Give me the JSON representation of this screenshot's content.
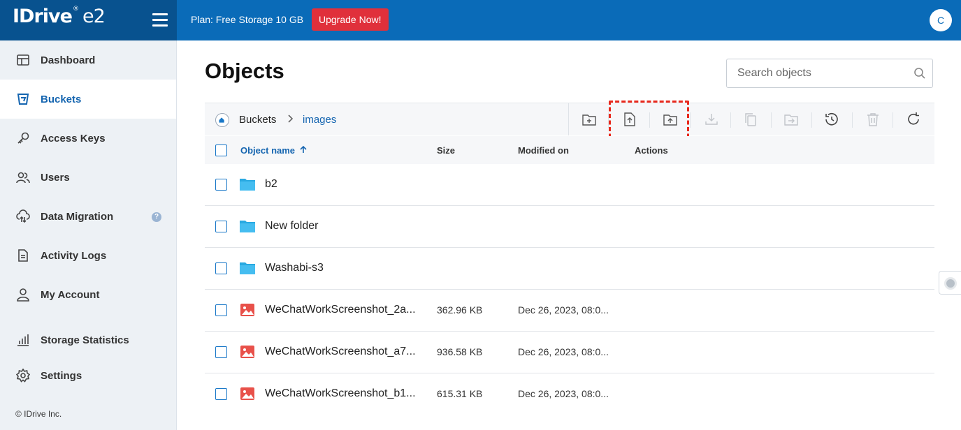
{
  "header": {
    "logo_text": "IDrive",
    "logo_suffix": "e2",
    "logo_mark": "®",
    "plan_text": "Plan: Free Storage 10 GB",
    "upgrade_label": "Upgrade Now!",
    "avatar_initial": "C"
  },
  "sidebar": {
    "items": [
      {
        "label": "Dashboard",
        "icon": "dashboard-icon"
      },
      {
        "label": "Buckets",
        "icon": "bucket-icon",
        "active": true
      },
      {
        "label": "Access Keys",
        "icon": "key-icon"
      },
      {
        "label": "Users",
        "icon": "users-icon"
      },
      {
        "label": "Data Migration",
        "icon": "cloud-migration-icon",
        "badge": "?"
      },
      {
        "label": "Activity Logs",
        "icon": "document-icon"
      },
      {
        "label": "My Account",
        "icon": "person-icon"
      },
      {
        "label": "Storage Statistics",
        "icon": "bar-chart-icon"
      },
      {
        "label": "Settings",
        "icon": "gear-icon"
      }
    ],
    "copyright": "© IDrive Inc."
  },
  "main": {
    "title": "Objects",
    "search_placeholder": "Search objects",
    "breadcrumb": {
      "root": "Buckets",
      "current": "images"
    },
    "toolbar": [
      {
        "name": "create-folder",
        "enabled": true
      },
      {
        "name": "upload-file",
        "enabled": true,
        "highlighted": true
      },
      {
        "name": "upload-folder",
        "enabled": true,
        "highlighted": true
      },
      {
        "name": "download",
        "enabled": false
      },
      {
        "name": "copy",
        "enabled": false
      },
      {
        "name": "move",
        "enabled": false
      },
      {
        "name": "version-history",
        "enabled": true
      },
      {
        "name": "delete",
        "enabled": false
      },
      {
        "name": "refresh",
        "enabled": true
      }
    ],
    "columns": {
      "name": "Object name",
      "size": "Size",
      "modified": "Modified on",
      "actions": "Actions"
    },
    "rows": [
      {
        "type": "folder",
        "name": "b2",
        "size": "",
        "modified": ""
      },
      {
        "type": "folder",
        "name": "New folder",
        "size": "",
        "modified": ""
      },
      {
        "type": "folder",
        "name": "Washabi-s3",
        "size": "",
        "modified": ""
      },
      {
        "type": "image",
        "name": "WeChatWorkScreenshot_2a...",
        "size": "362.96 KB",
        "modified": "Dec 26, 2023, 08:0..."
      },
      {
        "type": "image",
        "name": "WeChatWorkScreenshot_a7...",
        "size": "936.58 KB",
        "modified": "Dec 26, 2023, 08:0..."
      },
      {
        "type": "image",
        "name": "WeChatWorkScreenshot_b1...",
        "size": "615.31 KB",
        "modified": "Dec 26, 2023, 08:0..."
      }
    ]
  },
  "colors": {
    "brand_blue": "#0a6bb8",
    "brand_dark": "#08528f",
    "upgrade_red": "#e0303b",
    "link_blue": "#1565b0",
    "folder": "#29a9e1",
    "image_icon": "#e8514a",
    "highlight": "#e8281c"
  }
}
